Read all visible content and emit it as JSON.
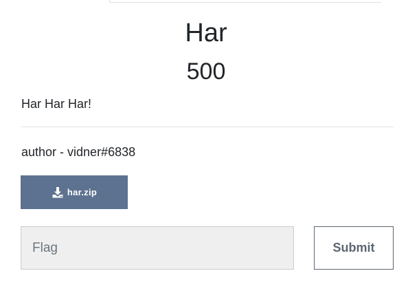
{
  "challenge": {
    "name": "Har",
    "value": "500",
    "description": "Har Har Har!",
    "author": "author - vidner#6838"
  },
  "files": [
    {
      "label": "har.zip",
      "icon": "download-icon"
    }
  ],
  "submission": {
    "placeholder": "Flag",
    "value": "",
    "submit_label": "Submit"
  },
  "colors": {
    "file_button_bg": "#5c7290",
    "input_bg": "#efefef",
    "submit_border": "#5c6670",
    "text": "#212529"
  }
}
